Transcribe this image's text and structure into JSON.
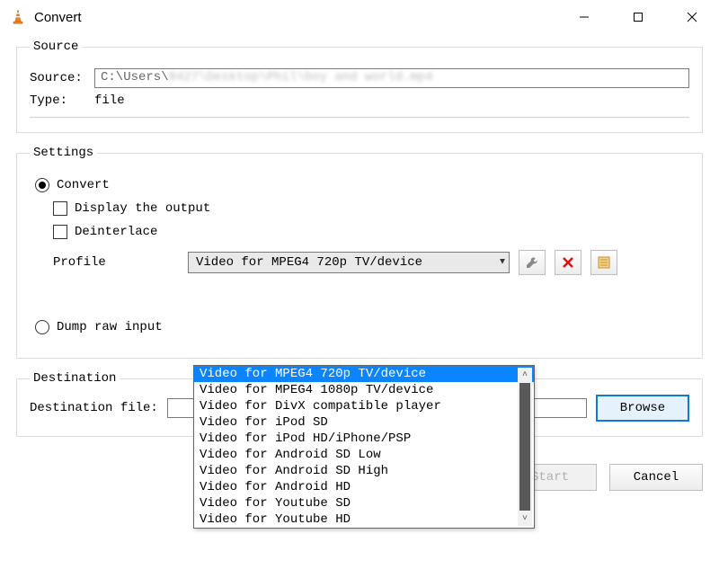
{
  "window": {
    "title": "Convert",
    "icon": "vlc-cone-icon"
  },
  "source_group": {
    "legend": "Source",
    "source_label": "Source:",
    "source_value_visible": "C:\\Users\\",
    "source_value_blurred": "0427\\Desktop\\Phil\\boy and world.mp4",
    "type_label": "Type:",
    "type_value": "file"
  },
  "settings_group": {
    "legend": "Settings",
    "convert_label": "Convert",
    "display_output_label": "Display the output",
    "deinterlace_label": "Deinterlace",
    "profile_label": "Profile",
    "profile_selected": "Video for MPEG4 720p TV/device",
    "profile_options": [
      "Video for MPEG4 720p TV/device",
      "Video for MPEG4 1080p TV/device",
      "Video for DivX compatible player",
      "Video for iPod SD",
      "Video for iPod HD/iPhone/PSP",
      "Video for Android SD Low",
      "Video for Android SD High",
      "Video for Android HD",
      "Video for Youtube SD",
      "Video for Youtube HD"
    ],
    "dump_label": "Dump raw input",
    "icons": {
      "wrench": "wrench-icon",
      "delete": "delete-x-icon",
      "new": "new-profile-icon"
    }
  },
  "destination_group": {
    "legend": "Destination",
    "file_label": "Destination file:",
    "browse_label": "Browse"
  },
  "footer": {
    "start_label": "Start",
    "cancel_label": "Cancel"
  }
}
